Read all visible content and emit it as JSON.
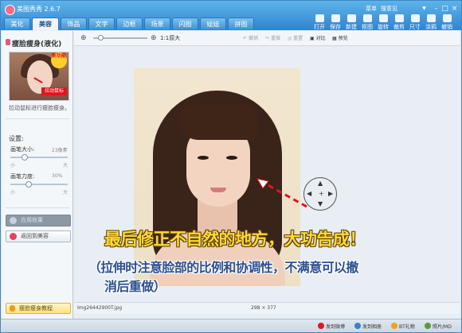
{
  "app": {
    "title": "美图秀秀 2.6.7"
  },
  "menu_links": [
    "菜单",
    "搜意见"
  ],
  "tabs": [
    "美化",
    "美容",
    "饰品",
    "文字",
    "边框",
    "场景",
    "闪图",
    "娃娃",
    "拼图"
  ],
  "active_tab": "美容",
  "toolbar": [
    "打开",
    "保存",
    "新建",
    "抠图",
    "旋转",
    "裁剪",
    "尺寸",
    "涂鸦",
    "撤销"
  ],
  "left_panel": {
    "title": "瘦脸瘦身(液化)",
    "thumbnail": {
      "badge": "新功能",
      "label": "拉动鼠标"
    },
    "hint": "拉动鼠标进行瘦脸瘦身。",
    "settings_title": "设置:",
    "brush_size": {
      "label": "画笔大小:",
      "value": "23像素",
      "min_label": "小",
      "max_label": "大",
      "level": 0.22
    },
    "brush_strength": {
      "label": "画笔力度:",
      "value": "30%",
      "min_label": "小",
      "max_label": "大",
      "level": 0.3
    },
    "apply_button": "应用效果",
    "back_button": "返回到美容",
    "tutorial_button": "瘦脸瘦身教程"
  },
  "canvas_toolbar": {
    "zoom_text": "1:1原大",
    "buttons": [
      "撤销",
      "重做",
      "重置",
      "对比",
      "预览"
    ],
    "zoom_level": 0.1
  },
  "overlay": {
    "headline": "最后修正不自然的地方，大功告成！",
    "subhead_line1": "（拉伸时注意脸部的比例和协调性，不满意可以撤",
    "subhead_line2": "消后重做）"
  },
  "image_info": {
    "filename": "Img26442900T.jpg",
    "dimensions": "298 × 377"
  },
  "status_bar": [
    "发到微博",
    "发到相册",
    "BT礼物",
    "照片/MD"
  ],
  "colors": {
    "title_bar": "#3b8fd6",
    "headline": "#ffd83a",
    "subhead": "#2c4f8f",
    "accent_red": "#e0151d"
  }
}
